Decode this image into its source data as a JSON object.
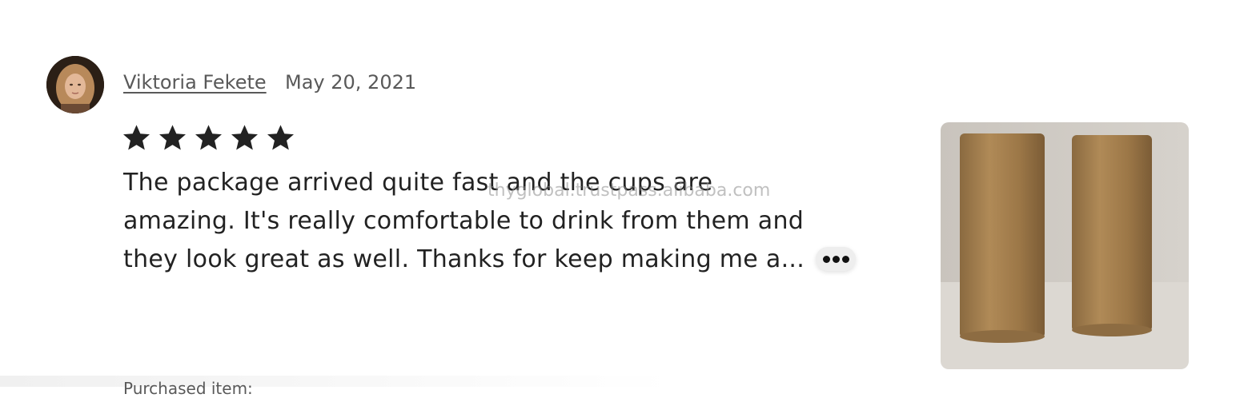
{
  "review": {
    "reviewer_name": "Viktoria Fekete",
    "date": "May 20, 2021",
    "rating": 5,
    "rating_max": 5,
    "text_lines": [
      "The package arrived quite fast and the cups are",
      "amazing. It's really comfortable to drink from them and",
      "they look great as well. Thanks for keep making me a..."
    ],
    "more_icon": "ellipsis-icon",
    "photo_icon": "review-photo-bamboo-cups"
  },
  "watermark": "thyglobal.trustpass.alibaba.com",
  "cutoff_text": "Purchased item:",
  "colors": {
    "text": "#222222",
    "muted": "#595959",
    "star": "#222222"
  }
}
